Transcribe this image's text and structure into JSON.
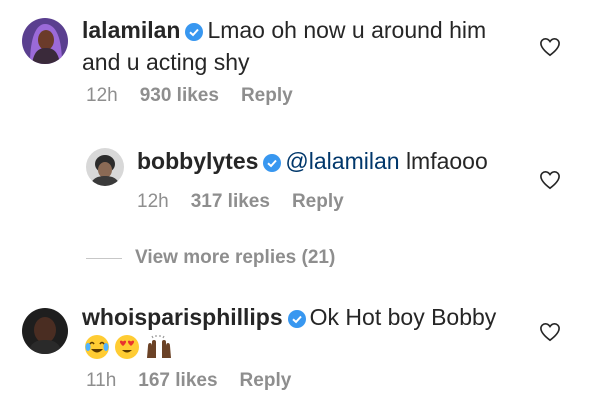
{
  "comments": [
    {
      "username": "lalamilan",
      "text_line1": "Lmao oh now u around him",
      "text_line2": "and u acting shy",
      "time": "12h",
      "likes": "930 likes",
      "reply": "Reply",
      "verified": true
    },
    {
      "username": "bobbylytes",
      "mention": "@lalamilan",
      "text": "lmfaooo",
      "time": "12h",
      "likes": "317 likes",
      "reply": "Reply",
      "verified": true
    },
    {
      "username": "whoisparisphillips",
      "text": "Ok Hot boy Bobby",
      "emojis": [
        "joy-emoji",
        "heart-eyes-emoji",
        "raised-hands-emoji"
      ],
      "time": "11h",
      "likes": "167 likes",
      "reply": "Reply",
      "verified": true
    }
  ],
  "view_more": "View more replies (21)",
  "colors": {
    "verified": "#3897f0",
    "meta": "#8e8e8e",
    "mention": "#00376b"
  }
}
